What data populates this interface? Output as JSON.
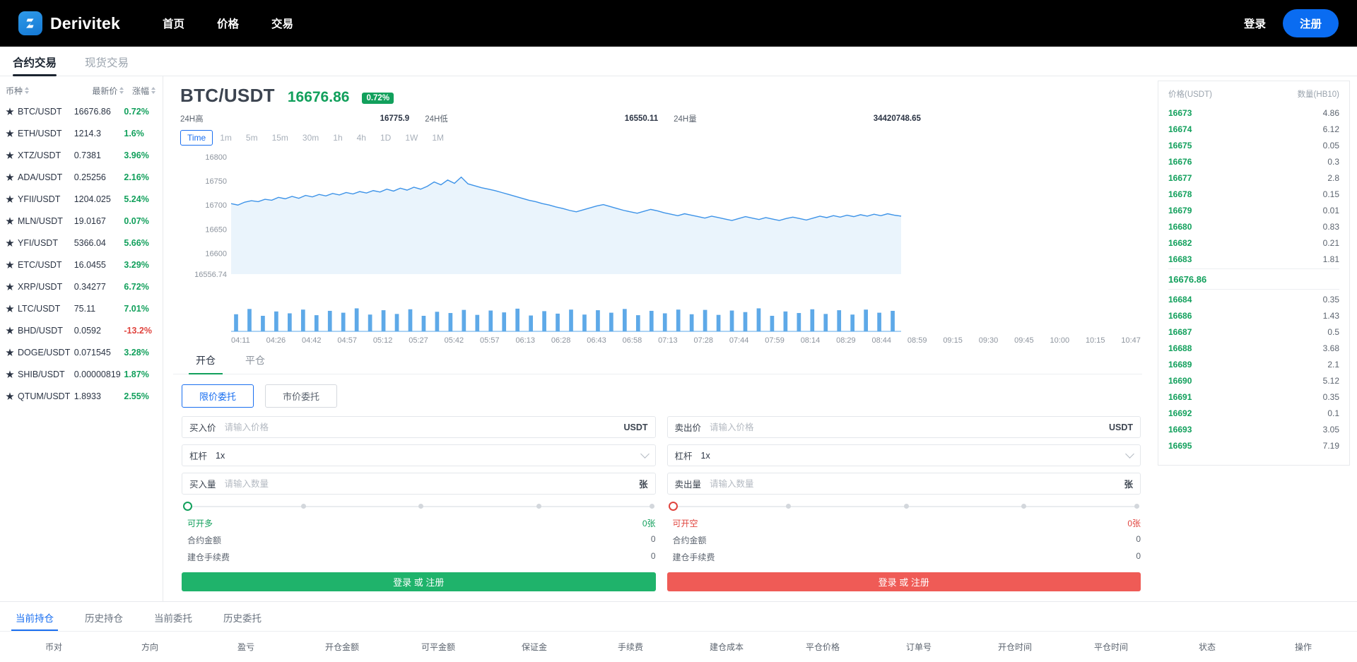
{
  "header": {
    "brand": "Derivitek",
    "nav": [
      "首页",
      "价格",
      "交易"
    ],
    "login": "登录",
    "register": "注册",
    "accent": "#0a6cf1"
  },
  "market_tabs": [
    {
      "label": "合约交易",
      "active": true
    },
    {
      "label": "现货交易",
      "active": false
    }
  ],
  "coinlist": {
    "headers": [
      "币种",
      "最新价",
      "涨幅"
    ],
    "rows": [
      {
        "symbol": "BTC/USDT",
        "price": "16676.86",
        "change": "0.72%",
        "dir": "up"
      },
      {
        "symbol": "ETH/USDT",
        "price": "1214.3",
        "change": "1.6%",
        "dir": "up"
      },
      {
        "symbol": "XTZ/USDT",
        "price": "0.7381",
        "change": "3.96%",
        "dir": "up"
      },
      {
        "symbol": "ADA/USDT",
        "price": "0.25256",
        "change": "2.16%",
        "dir": "up"
      },
      {
        "symbol": "YFII/USDT",
        "price": "1204.025",
        "change": "5.24%",
        "dir": "up"
      },
      {
        "symbol": "MLN/USDT",
        "price": "19.0167",
        "change": "0.07%",
        "dir": "up"
      },
      {
        "symbol": "YFI/USDT",
        "price": "5366.04",
        "change": "5.66%",
        "dir": "up"
      },
      {
        "symbol": "ETC/USDT",
        "price": "16.0455",
        "change": "3.29%",
        "dir": "up"
      },
      {
        "symbol": "XRP/USDT",
        "price": "0.34277",
        "change": "6.72%",
        "dir": "up"
      },
      {
        "symbol": "LTC/USDT",
        "price": "75.11",
        "change": "7.01%",
        "dir": "up"
      },
      {
        "symbol": "BHD/USDT",
        "price": "0.0592",
        "change": "-13.2%",
        "dir": "down"
      },
      {
        "symbol": "DOGE/USDT",
        "price": "0.071545",
        "change": "3.28%",
        "dir": "up"
      },
      {
        "symbol": "SHIB/USDT",
        "price": "0.00000819",
        "change": "1.87%",
        "dir": "up"
      },
      {
        "symbol": "QTUM/USDT",
        "price": "1.8933",
        "change": "2.55%",
        "dir": "up"
      }
    ]
  },
  "ticker": {
    "symbol": "BTC/USDT",
    "price": "16676.86",
    "change_badge": "0.72%",
    "high_label": "24H高",
    "high_value": "16775.9",
    "low_label": "24H低",
    "low_value": "16550.11",
    "vol_label": "24H量",
    "vol_value": "34420748.65"
  },
  "timeframes": [
    {
      "label": "Time",
      "active": true
    },
    {
      "label": "1m",
      "active": false
    },
    {
      "label": "5m",
      "active": false
    },
    {
      "label": "15m",
      "active": false
    },
    {
      "label": "30m",
      "active": false
    },
    {
      "label": "1h",
      "active": false
    },
    {
      "label": "4h",
      "active": false
    },
    {
      "label": "1D",
      "active": false
    },
    {
      "label": "1W",
      "active": false
    },
    {
      "label": "1M",
      "active": false
    }
  ],
  "chart_data": {
    "type": "line",
    "title": "BTC/USDT",
    "xlabel": "",
    "ylabel": "",
    "grid": false,
    "legend": "none",
    "line_color": "#3d93e8",
    "fill_color": "#eaf4fc",
    "ylim": [
      16556.74,
      16800
    ],
    "ytick_labels": [
      "16800",
      "16750",
      "16700",
      "16650",
      "16600",
      "16556.74"
    ],
    "yticks": [
      16800,
      16750,
      16700,
      16650,
      16600,
      16556.74
    ],
    "x": [
      "04:11",
      "04:26",
      "04:42",
      "04:57",
      "05:12",
      "05:27",
      "05:42",
      "05:57",
      "06:13",
      "06:28",
      "06:43",
      "06:58",
      "07:13",
      "07:28",
      "07:44",
      "07:59",
      "08:14",
      "08:29",
      "08:44",
      "08:59",
      "09:15",
      "09:30",
      "09:45",
      "10:00",
      "10:15",
      "10:47"
    ],
    "series": [
      {
        "name": "BTC/USDT",
        "values": [
          16703,
          16700,
          16706,
          16709,
          16707,
          16712,
          16710,
          16716,
          16713,
          16718,
          16714,
          16720,
          16717,
          16722,
          16719,
          16724,
          16721,
          16726,
          16723,
          16728,
          16725,
          16730,
          16727,
          16733,
          16729,
          16735,
          16731,
          16737,
          16733,
          16739,
          16748,
          16742,
          16752,
          16745,
          16758,
          16744,
          16740,
          16736,
          16733,
          16730,
          16726,
          16722,
          16718,
          16714,
          16710,
          16707,
          16703,
          16700,
          16696,
          16693,
          16689,
          16686,
          16690,
          16694,
          16698,
          16701,
          16697,
          16693,
          16689,
          16686,
          16683,
          16687,
          16691,
          16688,
          16684,
          16681,
          16678,
          16682,
          16679,
          16676,
          16673,
          16677,
          16674,
          16671,
          16668,
          16672,
          16676,
          16673,
          16670,
          16674,
          16671,
          16668,
          16672,
          16675,
          16672,
          16669,
          16673,
          16677,
          16674,
          16678,
          16675,
          16679,
          16676,
          16680,
          16677,
          16681,
          16678,
          16682,
          16679,
          16677
        ]
      }
    ],
    "volume": {
      "type": "bar",
      "bar_color": "#5ea9e8",
      "bars": [
        0.55,
        0.72,
        0.5,
        0.64,
        0.58,
        0.7,
        0.52,
        0.66,
        0.6,
        0.74,
        0.54,
        0.68,
        0.56,
        0.71,
        0.5,
        0.63,
        0.59,
        0.69,
        0.53,
        0.67,
        0.61,
        0.73,
        0.51,
        0.65,
        0.57,
        0.7,
        0.54,
        0.68,
        0.6,
        0.72,
        0.52,
        0.66,
        0.58,
        0.7,
        0.55,
        0.69,
        0.53,
        0.67,
        0.62,
        0.74,
        0.5,
        0.64,
        0.59,
        0.71,
        0.56,
        0.68,
        0.54,
        0.7,
        0.6,
        0.66
      ]
    }
  },
  "order_tabs": [
    {
      "label": "开仓",
      "active": true
    },
    {
      "label": "平仓",
      "active": false
    }
  ],
  "order_types": [
    {
      "label": "限价委托",
      "selected": true
    },
    {
      "label": "市价委托",
      "selected": false
    }
  ],
  "buy_form": {
    "price_label": "买入价",
    "price_placeholder": "请输入价格",
    "price_unit": "USDT",
    "lev_label": "杠杆",
    "lev_value": "1x",
    "amount_label": "买入量",
    "amount_placeholder": "请输入数量",
    "amount_unit": "张",
    "avail_label": "可开多",
    "avail_value": "0张",
    "rows": [
      {
        "label": "合约金额",
        "value": "0"
      },
      {
        "label": "建仓手续费",
        "value": "0"
      }
    ],
    "submit": "登录 或 注册"
  },
  "sell_form": {
    "price_label": "卖出价",
    "price_placeholder": "请输入价格",
    "price_unit": "USDT",
    "lev_label": "杠杆",
    "lev_value": "1x",
    "amount_label": "卖出量",
    "amount_placeholder": "请输入数量",
    "amount_unit": "张",
    "avail_label": "可开空",
    "avail_value": "0张",
    "rows": [
      {
        "label": "合约金额",
        "value": "0"
      },
      {
        "label": "建仓手续费",
        "value": "0"
      }
    ],
    "submit": "登录 或 注册"
  },
  "orderbook": {
    "price_header": "价格(USDT)",
    "qty_header": "数量(HB10)",
    "mid_price": "16676.86",
    "rows_top": [
      {
        "price": "16673",
        "qty": "4.86"
      },
      {
        "price": "16674",
        "qty": "6.12"
      },
      {
        "price": "16675",
        "qty": "0.05"
      },
      {
        "price": "16676",
        "qty": "0.3"
      },
      {
        "price": "16677",
        "qty": "2.8"
      },
      {
        "price": "16678",
        "qty": "0.15"
      },
      {
        "price": "16679",
        "qty": "0.01"
      },
      {
        "price": "16680",
        "qty": "0.83"
      },
      {
        "price": "16682",
        "qty": "0.21"
      },
      {
        "price": "16683",
        "qty": "1.81"
      }
    ],
    "rows_bottom": [
      {
        "price": "16684",
        "qty": "0.35"
      },
      {
        "price": "16686",
        "qty": "1.43"
      },
      {
        "price": "16687",
        "qty": "0.5"
      },
      {
        "price": "16688",
        "qty": "3.68"
      },
      {
        "price": "16689",
        "qty": "2.1"
      },
      {
        "price": "16690",
        "qty": "5.12"
      },
      {
        "price": "16691",
        "qty": "0.35"
      },
      {
        "price": "16692",
        "qty": "0.1"
      },
      {
        "price": "16693",
        "qty": "3.05"
      },
      {
        "price": "16695",
        "qty": "7.19"
      }
    ]
  },
  "positions": {
    "tabs": [
      {
        "label": "当前持仓",
        "active": true
      },
      {
        "label": "历史持仓",
        "active": false
      },
      {
        "label": "当前委托",
        "active": false
      },
      {
        "label": "历史委托",
        "active": false
      }
    ],
    "columns": [
      "币对",
      "方向",
      "盈亏",
      "开仓金额",
      "可平金额",
      "保证金",
      "手续费",
      "建仓成本",
      "平仓价格",
      "订单号",
      "开仓时间",
      "平仓时间",
      "状态",
      "操作"
    ]
  }
}
